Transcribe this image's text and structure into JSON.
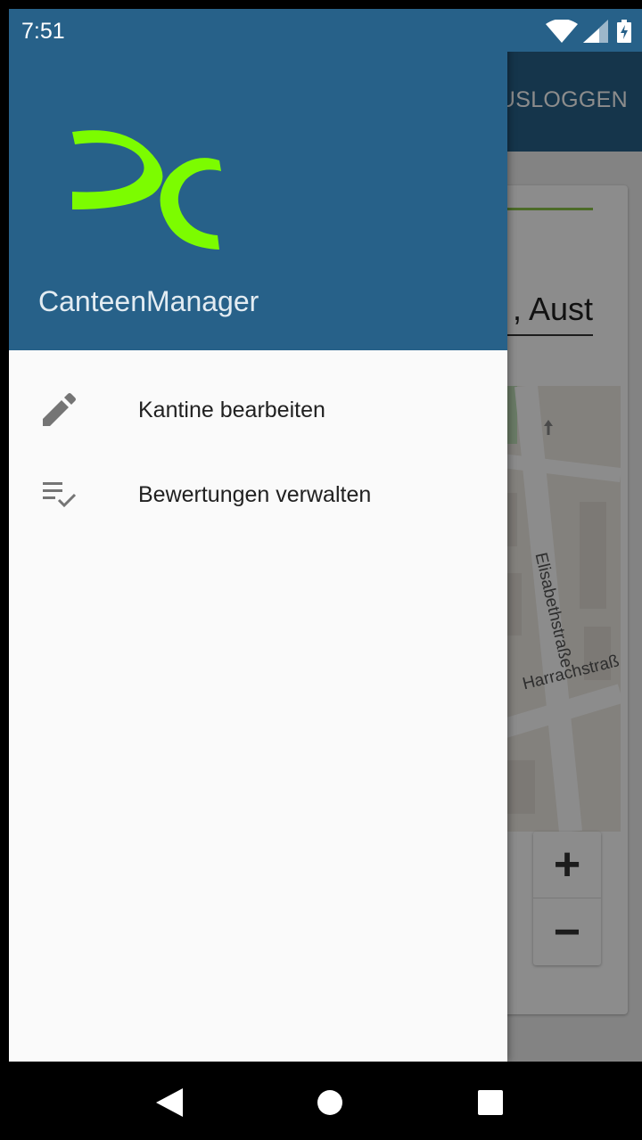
{
  "status_bar": {
    "time": "7:51",
    "icons": [
      "wifi-icon",
      "signal-icon",
      "battery-charging-icon"
    ]
  },
  "background_app": {
    "toolbar": {
      "logout_label": "USLOGGEN"
    },
    "address_field_value": ", Aust",
    "map": {
      "street_1": "Elisabethstraße",
      "street_2": "Harrachstraß",
      "zoom_in_label": "+",
      "zoom_out_label": "−"
    }
  },
  "drawer": {
    "app_name": "CanteenManager",
    "logo_color": "#7cfc00",
    "header_color": "#276189",
    "items": [
      {
        "label": "Kantine bearbeiten",
        "icon": "pencil-icon"
      },
      {
        "label": "Bewertungen verwalten",
        "icon": "playlist-check-icon"
      }
    ]
  },
  "nav_bar": {
    "buttons": [
      "back-icon",
      "home-icon",
      "recents-icon"
    ]
  }
}
